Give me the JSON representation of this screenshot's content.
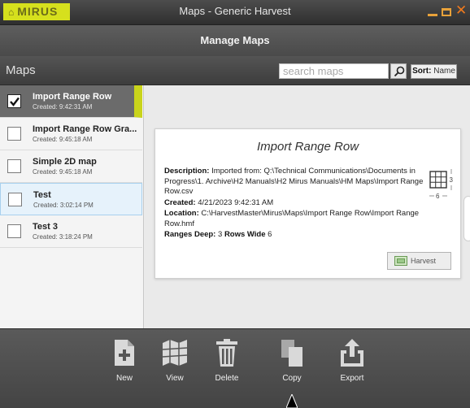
{
  "window": {
    "logo_text": "MIRUS",
    "title": "Maps - Generic Harvest"
  },
  "header": {
    "title": "Manage Maps"
  },
  "maps_bar": {
    "label": "Maps",
    "search_placeholder": "search maps",
    "sort_prefix": "Sort:",
    "sort_value": "Name"
  },
  "maps": [
    {
      "name": "Import Range Row",
      "created": "Created: 9:42:31 AM",
      "checked": true
    },
    {
      "name": "Import Range Row Gra...",
      "created": "Created: 9:45:18 AM",
      "checked": false
    },
    {
      "name": "Simple 2D map",
      "created": "Created: 9:45:18 AM",
      "checked": false
    },
    {
      "name": "Test",
      "created": "Created: 3:02:14 PM",
      "checked": false
    },
    {
      "name": "Test 3",
      "created": "Created: 3:18:24 PM",
      "checked": false
    }
  ],
  "detail": {
    "title": "Import Range Row",
    "description_label": "Description:",
    "description": "Imported from: Q:\\Technical Communications\\Documents in Progress\\1. Archive\\H2 Manuals\\H2 Mirus Manuals\\HM Maps\\Import Range Row.csv",
    "created_label": "Created:",
    "created": "4/21/2023 9:42:31 AM",
    "location_label": "Location:",
    "location": "C:\\HarvestMaster\\Mirus\\Maps\\Import Range Row\\Import Range Row.hmf",
    "ranges_label": "Ranges Deep:",
    "ranges_value": "3",
    "rows_label": "Rows Wide",
    "rows_value": "6",
    "grid_rows": "3",
    "grid_cols": "6",
    "harvest_label": "Harvest"
  },
  "toolbar": {
    "new": "New",
    "view": "View",
    "delete": "Delete",
    "copy": "Copy",
    "export": "Export"
  },
  "colors": {
    "accent": "#c9d41b",
    "close": "#f07a1d",
    "selected_row": "#6b6b6b"
  }
}
